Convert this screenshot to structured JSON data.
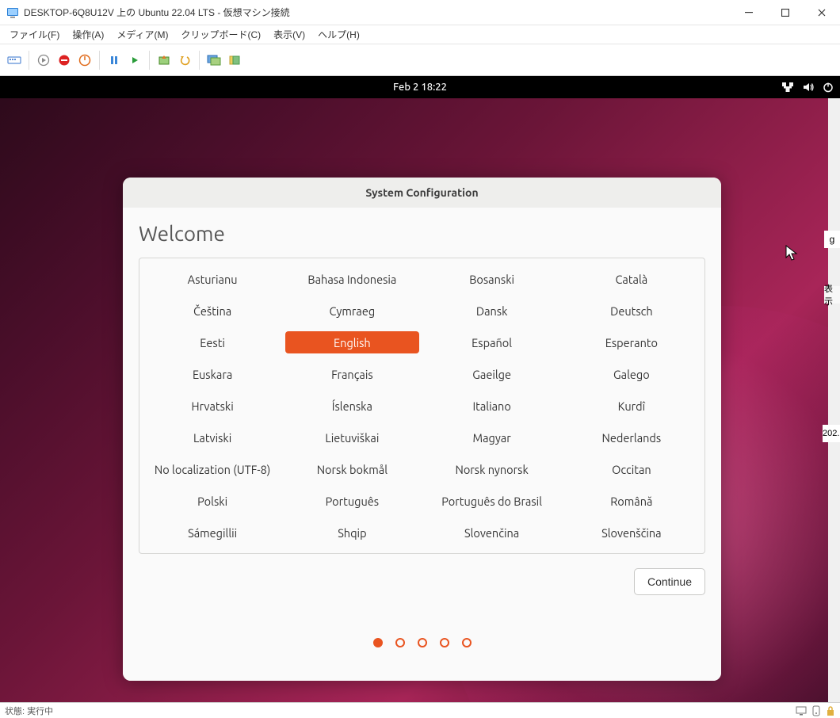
{
  "host": {
    "title": "DESKTOP-6Q8U12V 上の Ubuntu 22.04 LTS - 仮想マシン接続",
    "menus": [
      {
        "label": "ファイル(F)"
      },
      {
        "label": "操作(A)"
      },
      {
        "label": "メディア(M)"
      },
      {
        "label": "クリップボード(C)"
      },
      {
        "label": "表示(V)"
      },
      {
        "label": "ヘルプ(H)"
      }
    ],
    "status_left": "状態: 実行中"
  },
  "gnome": {
    "clock": "Feb 2  18:22"
  },
  "syscfg": {
    "title": "System Configuration",
    "welcome": "Welcome",
    "continue_label": "Continue",
    "selected": "English",
    "languages": [
      "Asturianu",
      "Bahasa Indonesia",
      "Bosanski",
      "Català",
      "Čeština",
      "Cymraeg",
      "Dansk",
      "Deutsch",
      "Eesti",
      "English",
      "Español",
      "Esperanto",
      "Euskara",
      "Français",
      "Gaeilge",
      "Galego",
      "Hrvatski",
      "Íslenska",
      "Italiano",
      "Kurdî",
      "Latviski",
      "Lietuviškai",
      "Magyar",
      "Nederlands",
      "No localization (UTF-8)",
      "Norsk bokmål",
      "Norsk nynorsk",
      "Occitan",
      "Polski",
      "Português",
      "Português do Brasil",
      "Română",
      "Sámegillii",
      "Shqip",
      "Slovenčina",
      "Slovenščina"
    ],
    "progress_total": 5,
    "progress_current": 1
  },
  "side_hint_1": "g",
  "side_hint_2": "表示",
  "side_hint_3": "202."
}
